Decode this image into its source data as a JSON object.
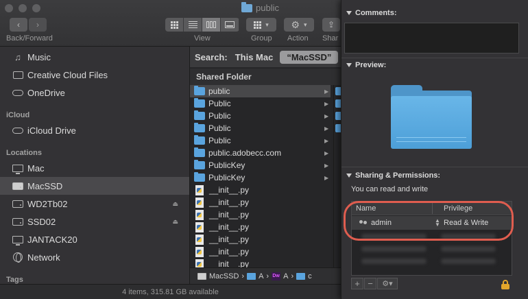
{
  "window": {
    "title": "public"
  },
  "toolbar": {
    "back_forward_label": "Back/Forward",
    "view_label": "View",
    "group_label": "Group",
    "action_label": "Action",
    "share_label": "Shar"
  },
  "sidebar": {
    "favorites": [
      {
        "label": "Music",
        "icon": "music-note-icon"
      },
      {
        "label": "Creative Cloud Files",
        "icon": "folder-icon"
      },
      {
        "label": "OneDrive",
        "icon": "cloud-icon"
      }
    ],
    "icloud_header": "iCloud",
    "icloud": [
      {
        "label": "iCloud Drive",
        "icon": "cloud-icon"
      }
    ],
    "locations_header": "Locations",
    "locations": [
      {
        "label": "Mac",
        "icon": "laptop-icon"
      },
      {
        "label": "MacSSD",
        "icon": "drive-icon",
        "selected": true
      },
      {
        "label": "WD2Tb02",
        "icon": "drive-icon",
        "eject": true
      },
      {
        "label": "SSD02",
        "icon": "drive-icon",
        "eject": true
      },
      {
        "label": "JANTACK20",
        "icon": "monitor-icon"
      },
      {
        "label": "Network",
        "icon": "globe-icon"
      }
    ],
    "tags_header": "Tags"
  },
  "search": {
    "label": "Search:",
    "scope_this_mac": "This Mac",
    "scope_selected": "“MacSSD”"
  },
  "results": {
    "header": "Shared Folder",
    "rows": [
      {
        "name": "public",
        "type": "folder",
        "selected": true
      },
      {
        "name": "Public",
        "type": "folder"
      },
      {
        "name": "Public",
        "type": "folder"
      },
      {
        "name": "Public",
        "type": "folder"
      },
      {
        "name": "Public",
        "type": "folder"
      },
      {
        "name": "public.adobecc.com",
        "type": "folder"
      },
      {
        "name": "PublicKey",
        "type": "folder"
      },
      {
        "name": "PublicKey",
        "type": "folder"
      },
      {
        "name": "__init__.py",
        "type": "python"
      },
      {
        "name": "__init__.py",
        "type": "python"
      },
      {
        "name": "__init__.py",
        "type": "python"
      },
      {
        "name": "__init__.py",
        "type": "python"
      },
      {
        "name": "__init__.py",
        "type": "python"
      },
      {
        "name": "__init__.py",
        "type": "python"
      },
      {
        "name": "__init__.py",
        "type": "python"
      }
    ]
  },
  "pathbar": {
    "disk": "MacSSD",
    "seg1": "A",
    "seg2": "A",
    "seg3": "c"
  },
  "status": {
    "text": "4 items, 315.81 GB available"
  },
  "info": {
    "comments_label": "Comments:",
    "preview_label": "Preview:",
    "sharing_label": "Sharing & Permissions:",
    "access_text": "You can read and write",
    "table": {
      "col_name": "Name",
      "col_privilege": "Privilege",
      "rows": [
        {
          "name": "admin",
          "privilege": "Read & Write"
        }
      ]
    },
    "add_symbol": "+",
    "remove_symbol": "−",
    "action_symbol": "⚙▾"
  }
}
